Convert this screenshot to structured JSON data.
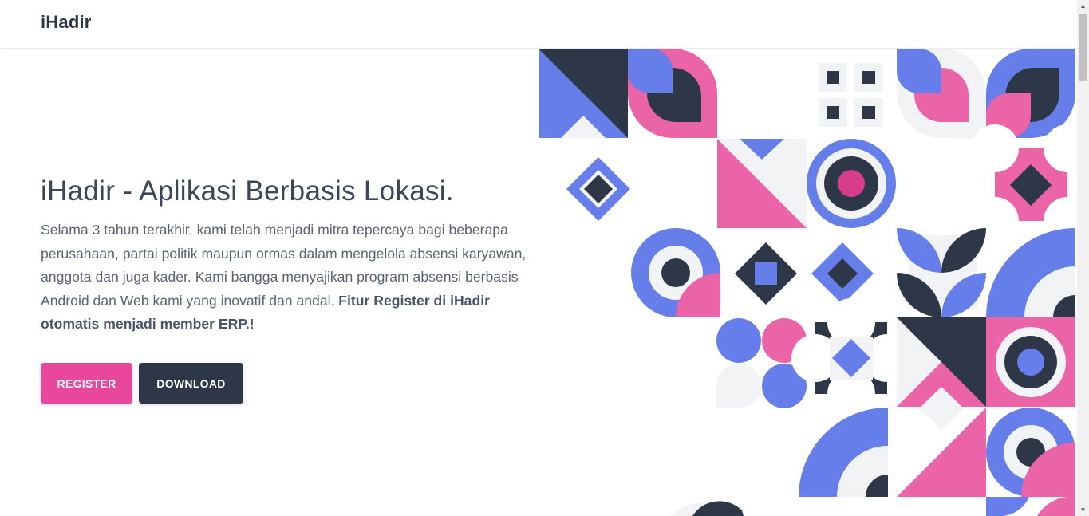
{
  "navbar": {
    "brand": "iHadir"
  },
  "hero": {
    "title": "iHadir - Aplikasi Berbasis Lokasi.",
    "description": "Selama 3 tahun terakhir, kami telah menjadi mitra tepercaya bagi beberapa perusahaan, partai politik maupun ormas dalam mengelola absensi karyawan, anggota dan juga kader. Kami bangga menyajikan program absensi berbasis Android dan Web kami yang inovatif dan andal.",
    "description_bold": "Fitur Register di iHadir otomatis menjadi member ERP.!",
    "register_label": "REGISTER",
    "download_label": "DOWNLOAD"
  },
  "colors": {
    "pink": "#ec64a8",
    "blue": "#667eea",
    "navy": "#2d3748",
    "light": "#f2f3f5",
    "register_button": "#e8479c",
    "download_button": "#2d3748"
  },
  "scrollbar": {
    "up_icon": "triangle-up-icon",
    "down_icon": "triangle-down-icon"
  }
}
